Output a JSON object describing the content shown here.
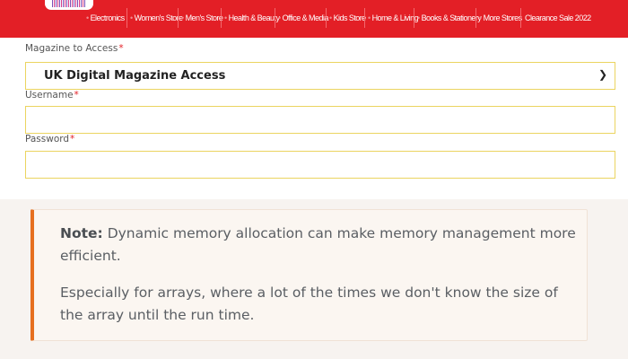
{
  "header": {
    "logo_name": "store-logo",
    "nav": [
      "Electronics",
      "Women's Store",
      "Men's Store",
      "Health & Beauty",
      "Office & Media",
      "Kids Store",
      "Home & Living",
      "Books & Stationery",
      "More Stores",
      "Clearance Sale 2022"
    ],
    "colors": {
      "bar": "#e31f26",
      "text": "#ffffff"
    }
  },
  "form": {
    "magazine": {
      "label": "Magazine to Access",
      "required_mark": "*",
      "selected": "UK Digital Magazine Access"
    },
    "username": {
      "label": "Username",
      "required_mark": "*",
      "value": ""
    },
    "password": {
      "label": "Password",
      "required_mark": "*",
      "value": ""
    },
    "field_border_color": "#ebd460"
  },
  "note": {
    "label": "Note:",
    "line1": "Dynamic memory allocation can make memory management more efficient.",
    "line2": "Especially for arrays, where a lot of the times we don't know the size of the array until the run time.",
    "accent_color": "#e66f1f"
  }
}
